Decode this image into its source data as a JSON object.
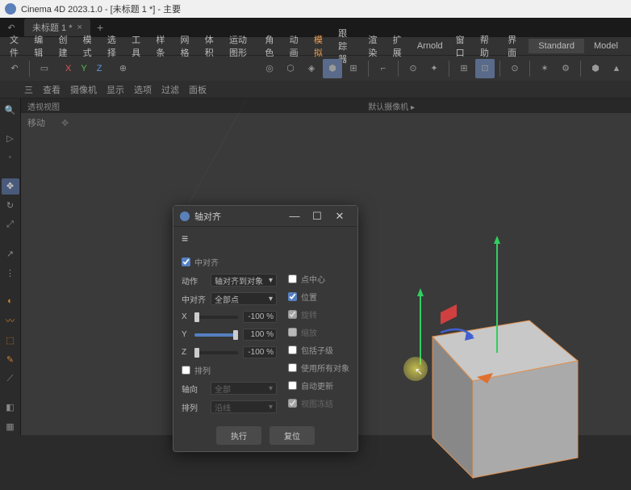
{
  "app": {
    "title": "Cinema 4D 2023.1.0 - [未标题 1 *] - 主要"
  },
  "tabs": {
    "doc": "未标题 1 *"
  },
  "menu": {
    "items": [
      "文件",
      "编辑",
      "创建",
      "模式",
      "选择",
      "工具",
      "样条",
      "网格",
      "体积",
      "运动图形",
      "角色",
      "动画",
      "模拟",
      "跟踪器",
      "渲染",
      "扩展",
      "Arnold",
      "窗口",
      "帮助"
    ],
    "active_index": 12,
    "layout": "界面",
    "standard": "Standard",
    "model": "Model"
  },
  "axes": {
    "x": "X",
    "y": "Y",
    "z": "Z"
  },
  "subbar": {
    "items": [
      "三",
      "查看",
      "摄像机",
      "显示",
      "选项",
      "过滤",
      "面板"
    ]
  },
  "viewport": {
    "title": "透视视图",
    "camera": "默认摄像机",
    "move": "移动"
  },
  "dialog": {
    "title": "轴对齐",
    "center_align": "中对齐",
    "action_label": "动作",
    "action_value": "轴对齐到对象",
    "mid_align_label": "中对齐",
    "mid_align_value": "全部点",
    "x_label": "X",
    "x_val": "-100 %",
    "y_label": "Y",
    "y_val": "100 %",
    "z_label": "Z",
    "z_val": "-100 %",
    "arrange": "排列",
    "axis_label": "轴向",
    "axis_value": "全部",
    "arrange_label": "排列",
    "arrange_value": "沿线",
    "point_center": "点中心",
    "position": "位置",
    "rotation": "旋转",
    "scale": "缩放",
    "include_children": "包括子级",
    "use_all_objects": "使用所有对象",
    "auto_update": "自动更新",
    "freeze": "视图冻结",
    "execute": "执行",
    "reset": "复位"
  }
}
